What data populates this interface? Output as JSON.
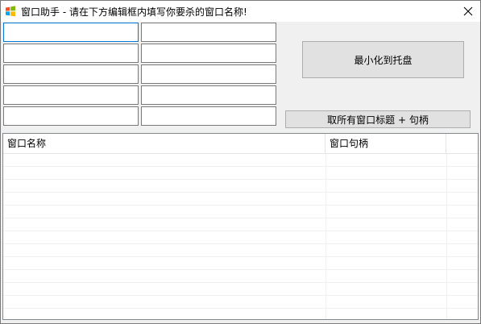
{
  "window": {
    "title": "窗口助手 - 请在下方编辑框内填写你要杀的窗口名称!"
  },
  "inputs": [
    {
      "value": "",
      "placeholder": ""
    },
    {
      "value": "",
      "placeholder": ""
    },
    {
      "value": "",
      "placeholder": ""
    },
    {
      "value": "",
      "placeholder": ""
    },
    {
      "value": "",
      "placeholder": ""
    },
    {
      "value": "",
      "placeholder": ""
    },
    {
      "value": "",
      "placeholder": ""
    },
    {
      "value": "",
      "placeholder": ""
    },
    {
      "value": "",
      "placeholder": ""
    },
    {
      "value": "",
      "placeholder": ""
    }
  ],
  "buttons": {
    "minimize_to_tray": "最小化到托盘",
    "get_titles": "取所有窗口标题 + 句柄"
  },
  "listview": {
    "columns": [
      "窗口名称",
      "窗口句柄"
    ],
    "rows": []
  },
  "colors": {
    "focus_border": "#0078d7",
    "button_face": "#e1e1e1",
    "window_bg": "#f0f0f0"
  },
  "icons": {
    "app": "windows-flag-icon",
    "close": "close-icon"
  }
}
